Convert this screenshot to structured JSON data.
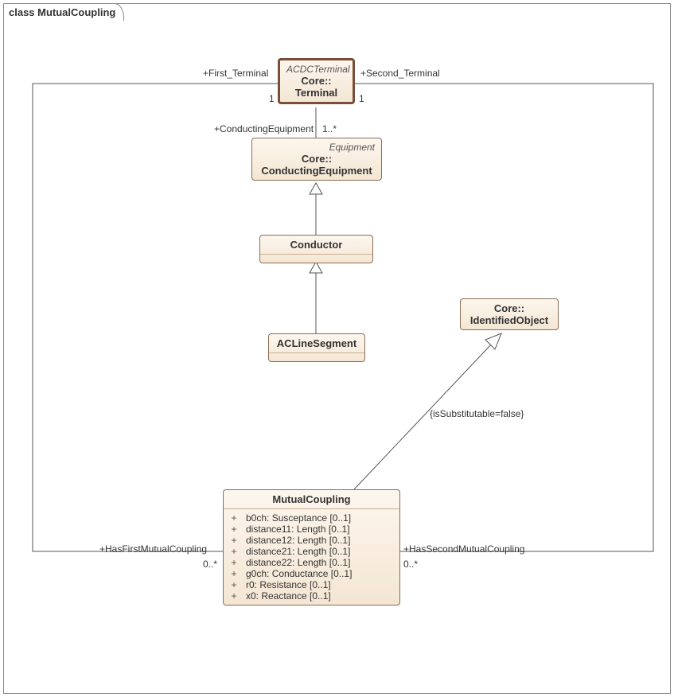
{
  "frame_title": "class MutualCoupling",
  "labels": {
    "first_terminal": "+First_Terminal",
    "second_terminal": "+Second_Terminal",
    "mult_1a": "1",
    "mult_1b": "1",
    "conducting_equipment": "+ConductingEquipment",
    "mult_1star": "1..*",
    "constraint": "{isSubstitutable=false}",
    "has_first": "+HasFirstMutualCoupling",
    "has_second": "+HasSecondMutualCoupling",
    "mult_0star_a": "0..*",
    "mult_0star_b": "0..*"
  },
  "classes": {
    "terminal": {
      "stereo": "ACDCTerminal",
      "pkg": "Core::",
      "name": "Terminal"
    },
    "conducting_equipment": {
      "stereo": "Equipment",
      "pkg": "Core::",
      "name": "ConductingEquipment"
    },
    "conductor": {
      "name": "Conductor"
    },
    "acline": {
      "name": "ACLineSegment"
    },
    "identified": {
      "pkg": "Core::",
      "name": "IdentifiedObject"
    },
    "mutual": {
      "name": "MutualCoupling",
      "attrs": [
        {
          "vis": "+",
          "sig": "b0ch: Susceptance [0..1]"
        },
        {
          "vis": "+",
          "sig": "distance11: Length [0..1]"
        },
        {
          "vis": "+",
          "sig": "distance12: Length [0..1]"
        },
        {
          "vis": "+",
          "sig": "distance21: Length [0..1]"
        },
        {
          "vis": "+",
          "sig": "distance22: Length [0..1]"
        },
        {
          "vis": "+",
          "sig": "g0ch: Conductance [0..1]"
        },
        {
          "vis": "+",
          "sig": "r0: Resistance [0..1]"
        },
        {
          "vis": "+",
          "sig": "x0: Reactance [0..1]"
        }
      ]
    }
  }
}
